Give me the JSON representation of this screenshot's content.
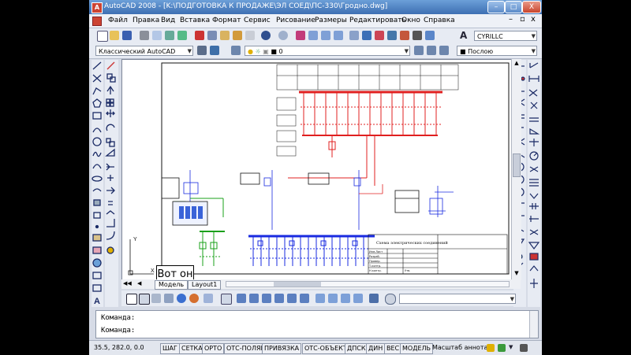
{
  "window": {
    "title": "AutoCAD 2008 - [K:\\ПОДГОТОВКА К ПРОДАЖЕ\\ЭЛ СОЕД\\ПС-330\\Гродно.dwg]",
    "app_icon_letter": "A",
    "controls": {
      "minimize": "–",
      "maximize": "□",
      "close": "X"
    }
  },
  "menu": [
    "Файл",
    "Правка",
    "Вид",
    "Вставка",
    "Формат",
    "Сервис",
    "Рисование",
    "Размеры",
    "Редактировать",
    "Окно",
    "Справка"
  ],
  "doc_controls": {
    "minimize": "–",
    "restore": "▫",
    "close": "x"
  },
  "toolbar": {
    "text_style_icon": "A",
    "text_style": "CYRILLC",
    "workspace": "Классический AutoCAD",
    "layer_name": "0",
    "linetype": "Послою"
  },
  "drawing": {
    "title_block_text": "Схема электрических соединений",
    "title_block_rows": [
      "Изм.Лист",
      "Разраб.",
      "Провер.",
      "Т.контр.",
      "Н.контр.",
      "Утв."
    ],
    "callout": "Вот он",
    "ucs_x": "X",
    "ucs_y": "Y"
  },
  "tabs": {
    "model": "Модель",
    "layout1": "Layout1"
  },
  "command": {
    "line1": "Команда:",
    "line2": "Команда:"
  },
  "status": {
    "coords": "35.5,  282.0,  0.0",
    "buttons": [
      "ШАГ",
      "СЕТКА",
      "ОРТО",
      "ОТС-ПОЛЯР",
      "ПРИВЯЗКА",
      "ОТС-ОБЪЕКТ",
      "ДПСК",
      "ДИН",
      "ВЕС",
      "МОДЕЛЬ"
    ],
    "annotation_scale": "Масштаб аннотаций"
  },
  "colors": {
    "title_bar": "#3d6fb3",
    "toolbar_bg": "#e7ebf3",
    "schematic_red": "#e02020",
    "schematic_blue": "#1a2be0",
    "schematic_green": "#1aa01a",
    "schematic_black": "#111111"
  }
}
